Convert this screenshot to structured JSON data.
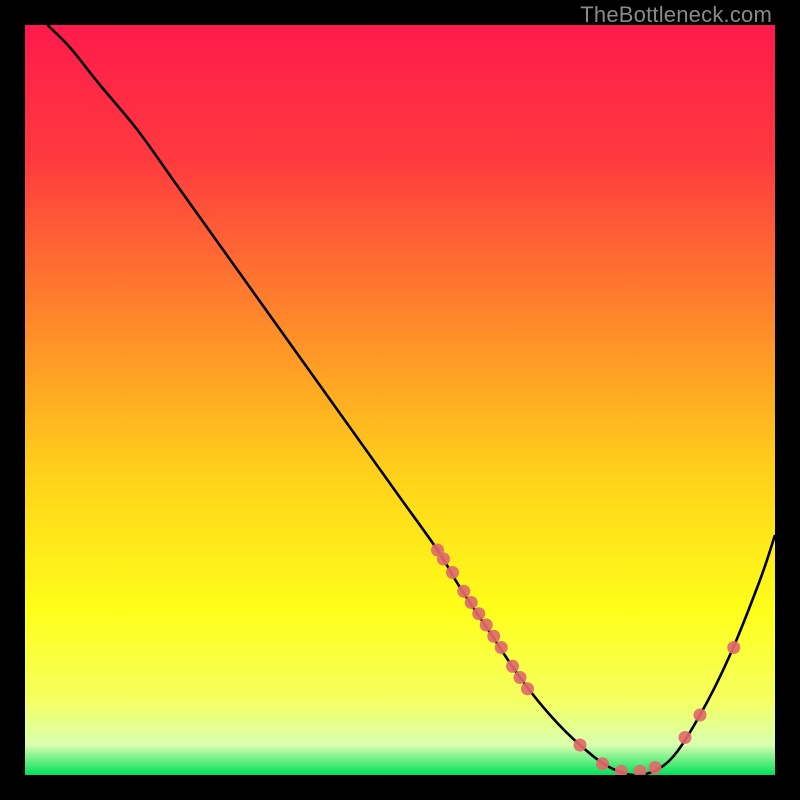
{
  "watermark": "TheBottleneck.com",
  "chart_data": {
    "type": "line",
    "title": "",
    "xlabel": "",
    "ylabel": "",
    "xlim": [
      0,
      100
    ],
    "ylim": [
      0,
      100
    ],
    "grid": false,
    "legend": "none",
    "gradient_stops": [
      {
        "pos": 0.0,
        "color": "#ff1a4b"
      },
      {
        "pos": 0.18,
        "color": "#ff3a3f"
      },
      {
        "pos": 0.4,
        "color": "#ff8a2a"
      },
      {
        "pos": 0.6,
        "color": "#ffd21a"
      },
      {
        "pos": 0.78,
        "color": "#ffff1a"
      },
      {
        "pos": 0.9,
        "color": "#f5ff60"
      },
      {
        "pos": 0.96,
        "color": "#d9ffb0"
      },
      {
        "pos": 1.0,
        "color": "#00e05a"
      }
    ],
    "series": [
      {
        "name": "bottleneck-v-curve",
        "color": "#000000",
        "x": [
          3,
          6,
          10,
          15,
          20,
          25,
          30,
          35,
          40,
          45,
          50,
          55,
          58,
          62,
          66,
          70,
          74,
          78,
          82,
          86,
          90,
          94,
          98,
          100
        ],
        "y": [
          100,
          97,
          92,
          86,
          79,
          72,
          65,
          58,
          51,
          44,
          37,
          30,
          25,
          19,
          13,
          8,
          4,
          1,
          0,
          2,
          8,
          16,
          26,
          32
        ]
      }
    ],
    "scatter": [
      {
        "name": "highlight-points-salmon",
        "color": "#e06a6a",
        "radius": 6.5,
        "points": [
          {
            "x": 55.0,
            "y": 30.0
          },
          {
            "x": 55.8,
            "y": 28.8
          },
          {
            "x": 57.0,
            "y": 27.0
          },
          {
            "x": 58.5,
            "y": 24.5
          },
          {
            "x": 59.5,
            "y": 23.0
          },
          {
            "x": 60.5,
            "y": 21.5
          },
          {
            "x": 61.5,
            "y": 20.0
          },
          {
            "x": 62.5,
            "y": 18.5
          },
          {
            "x": 63.5,
            "y": 17.0
          },
          {
            "x": 65.0,
            "y": 14.5
          },
          {
            "x": 66.0,
            "y": 13.0
          },
          {
            "x": 67.0,
            "y": 11.5
          },
          {
            "x": 74.0,
            "y": 4.0
          },
          {
            "x": 77.0,
            "y": 1.5
          },
          {
            "x": 79.5,
            "y": 0.5
          },
          {
            "x": 82.0,
            "y": 0.5
          },
          {
            "x": 84.0,
            "y": 1.0
          },
          {
            "x": 88.0,
            "y": 5.0
          },
          {
            "x": 90.0,
            "y": 8.0
          },
          {
            "x": 94.5,
            "y": 17.0
          }
        ]
      }
    ]
  }
}
